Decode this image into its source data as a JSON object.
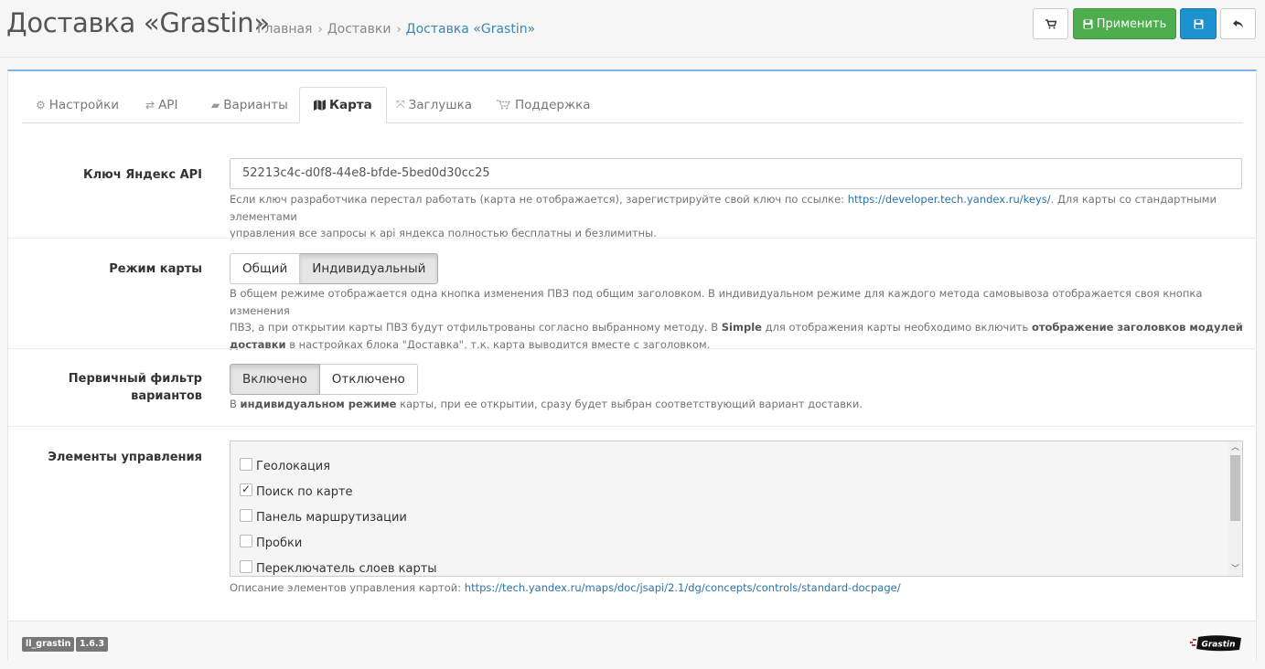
{
  "header": {
    "title": "Доставка «Grastin»",
    "breadcrumb": [
      "Главная",
      "Доставки",
      "Доставка «Grastin»"
    ],
    "buttons": {
      "apply_label": "Применить"
    }
  },
  "tabs": [
    {
      "label": "Настройки",
      "icon": "cogs-icon"
    },
    {
      "label": "API",
      "icon": "exchange-icon"
    },
    {
      "label": "Варианты",
      "icon": "truck-icon"
    },
    {
      "label": "Карта",
      "icon": "map-icon",
      "active": true
    },
    {
      "label": "Заглушка",
      "icon": "arrows-icon"
    },
    {
      "label": "Поддержка",
      "icon": "cart-icon"
    }
  ],
  "fields": {
    "api_key": {
      "label": "Ключ Яндекс API",
      "value": "52213c4c-d0f8-44e8-bfde-5bed0d30cc25",
      "help_1": "Если ключ разработчика перестал работать (карта не отображается), зарегистрируйте свой ключ по ссылке: ",
      "help_link": "https://developer.tech.yandex.ru/keys/",
      "help_2": ". Для карты со стандартными элементами",
      "help_3": "управления все запросы к api яндекса полностью бесплатны и безлимитны."
    },
    "map_mode": {
      "label": "Режим карты",
      "options": [
        "Общий",
        "Индивидуальный"
      ],
      "selected": "Индивидуальный",
      "help_1": "В общем режиме отображается одна кнопка изменения ПВЗ под общим заголовком. В индивидуальном режиме для каждого метода самовывоза отображается своя кнопка изменения",
      "help_2a": "ПВЗ, а при открытии карты ПВЗ будут отфильтрованы согласно выбранному методу. В ",
      "help_2b": "Simple",
      "help_2c": " для отображения карты необходимо включить ",
      "help_2d": "отображение заголовков модулей",
      "help_3a": "доставки",
      "help_3b": " в настройках блока \"Доставка\", т.к. карта выводится вместе с заголовком."
    },
    "primary_filter": {
      "label_1": "Первичный фильтр",
      "label_2": "вариантов",
      "options": [
        "Включено",
        "Отключено"
      ],
      "selected": "Включено",
      "help_a": "В ",
      "help_b": "индивидуальном режиме",
      "help_c": " карты, при ее открытии, сразу будет выбран соответствующий вариант доставки."
    },
    "controls": {
      "label": "Элементы управления",
      "items": [
        {
          "label": "Геолокация",
          "checked": false
        },
        {
          "label": "Поиск по карте",
          "checked": true
        },
        {
          "label": "Панель маршрутизации",
          "checked": false
        },
        {
          "label": "Пробки",
          "checked": false
        },
        {
          "label": "Переключатель слоев карты",
          "checked": false
        }
      ],
      "help_1": "Описание элементов управления картой: ",
      "help_link": "https://tech.yandex.ru/maps/doc/jsapi/2.1/dg/concepts/controls/standard-docpage/"
    }
  },
  "footer": {
    "module_badge": "ll_grastin",
    "version_badge": "1.6.3",
    "logo_text": "Grastin"
  },
  "colors": {
    "apply": "#4cae4c",
    "save": "#1e91cf",
    "link": "#2a73a8",
    "panel_top": "#7bb7e4"
  }
}
